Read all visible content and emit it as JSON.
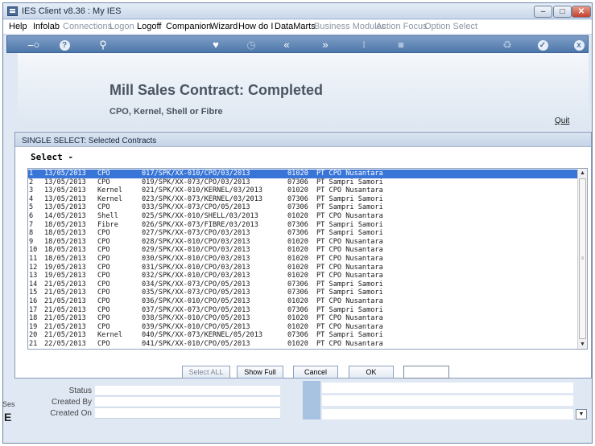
{
  "window": {
    "title": "IES Client v8.36 : My IES"
  },
  "menu": [
    {
      "label": "Help",
      "disabled": false
    },
    {
      "label": "Infolab",
      "disabled": false
    },
    {
      "label": "Connections",
      "disabled": true
    },
    {
      "label": "Logon",
      "disabled": true
    },
    {
      "label": "Logoff",
      "disabled": false
    },
    {
      "label": "Companion",
      "disabled": false
    },
    {
      "label": "Wizard",
      "disabled": false
    },
    {
      "label": "How do I",
      "disabled": false
    },
    {
      "label": "DataMarts",
      "disabled": false
    },
    {
      "label": "Business Modules",
      "disabled": true
    },
    {
      "label": "Action Focus",
      "disabled": true
    },
    {
      "label": "Option Select",
      "disabled": true
    }
  ],
  "toolbar_icons": [
    "key-icon",
    "help-icon",
    "search-icon",
    "heart-icon",
    "clock-icon",
    "rewind-icon",
    "fast-forward-icon",
    "cursor-icon",
    "stop-icon",
    "recycle-icon",
    "check-icon",
    "close-icon"
  ],
  "header": {
    "title": "Mill Sales Contract: Completed",
    "subtitle": "CPO, Kernel, Shell or Fibre",
    "quit": "Quit"
  },
  "dialog": {
    "title": "SINGLE SELECT: Selected Contracts",
    "select_label": "Select -",
    "selected_index": 0,
    "rows": [
      [
        "1",
        "13/05/2013",
        "CPO",
        "017/SPK/XX-010/CPO/03/2013",
        "01020",
        "PT CPO Nusantara"
      ],
      [
        "2",
        "13/05/2013",
        "CPO",
        "019/SPK/XX-073/CPO/03/2013",
        "07306",
        "PT Sampri Samori"
      ],
      [
        "3",
        "13/05/2013",
        "Kernel",
        "021/SPK/XX-010/KERNEL/03/2013",
        "01020",
        "PT CPO Nusantara"
      ],
      [
        "4",
        "13/05/2013",
        "Kernel",
        "023/SPK/XX-073/KERNEL/03/2013",
        "07306",
        "PT Sampri Samori"
      ],
      [
        "5",
        "13/05/2013",
        "CPO",
        "033/SPK/XX-073/CPO/05/2013",
        "07306",
        "PT Sampri Samori"
      ],
      [
        "6",
        "14/05/2013",
        "Shell",
        "025/SPK/XX-010/SHELL/03/2013",
        "01020",
        "PT CPO Nusantara"
      ],
      [
        "7",
        "18/05/2013",
        "Fibre",
        "026/SPK/XX-073/FIBRE/03/2013",
        "07306",
        "PT Sampri Samori"
      ],
      [
        "8",
        "18/05/2013",
        "CPO",
        "027/SPK/XX-073/CPO/03/2013",
        "07306",
        "PT Sampri Samori"
      ],
      [
        "9",
        "18/05/2013",
        "CPO",
        "028/SPK/XX-010/CPO/03/2013",
        "01020",
        "PT CPO Nusantara"
      ],
      [
        "10",
        "18/05/2013",
        "CPO",
        "029/SPK/XX-010/CPO/03/2013",
        "01020",
        "PT CPO Nusantara"
      ],
      [
        "11",
        "18/05/2013",
        "CPO",
        "030/SPK/XX-010/CPO/03/2013",
        "01020",
        "PT CPO Nusantara"
      ],
      [
        "12",
        "19/05/2013",
        "CPO",
        "031/SPK/XX-010/CPO/03/2013",
        "01020",
        "PT CPO Nusantara"
      ],
      [
        "13",
        "19/05/2013",
        "CPO",
        "032/SPK/XX-010/CPO/03/2013",
        "01020",
        "PT CPO Nusantara"
      ],
      [
        "14",
        "21/05/2013",
        "CPO",
        "034/SPK/XX-073/CPO/05/2013",
        "07306",
        "PT Sampri Samori"
      ],
      [
        "15",
        "21/05/2013",
        "CPO",
        "035/SPK/XX-073/CPO/05/2013",
        "07306",
        "PT Sampri Samori"
      ],
      [
        "16",
        "21/05/2013",
        "CPO",
        "036/SPK/XX-010/CPO/05/2013",
        "01020",
        "PT CPO Nusantara"
      ],
      [
        "17",
        "21/05/2013",
        "CPO",
        "037/SPK/XX-073/CPO/05/2013",
        "07306",
        "PT Sampri Samori"
      ],
      [
        "18",
        "21/05/2013",
        "CPO",
        "038/SPK/XX-010/CPO/05/2013",
        "01020",
        "PT CPO Nusantara"
      ],
      [
        "19",
        "21/05/2013",
        "CPO",
        "039/SPK/XX-010/CPO/05/2013",
        "01020",
        "PT CPO Nusantara"
      ],
      [
        "20",
        "21/05/2013",
        "Kernel",
        "040/SPK/XX-073/KERNEL/05/2013",
        "07306",
        "PT Sampri Samori"
      ],
      [
        "21",
        "22/05/2013",
        "CPO",
        "041/SPK/XX-010/CPO/05/2013",
        "01020",
        "PT CPO Nusantara"
      ]
    ],
    "buttons": {
      "select_all": "Select ALL",
      "show_full_line": "Show Full Line",
      "cancel": "Cancel",
      "ok": "OK"
    }
  },
  "form": {
    "status_label": "Status",
    "created_by_label": "Created By",
    "created_on_label": "Created On",
    "side_text": "Ses"
  }
}
